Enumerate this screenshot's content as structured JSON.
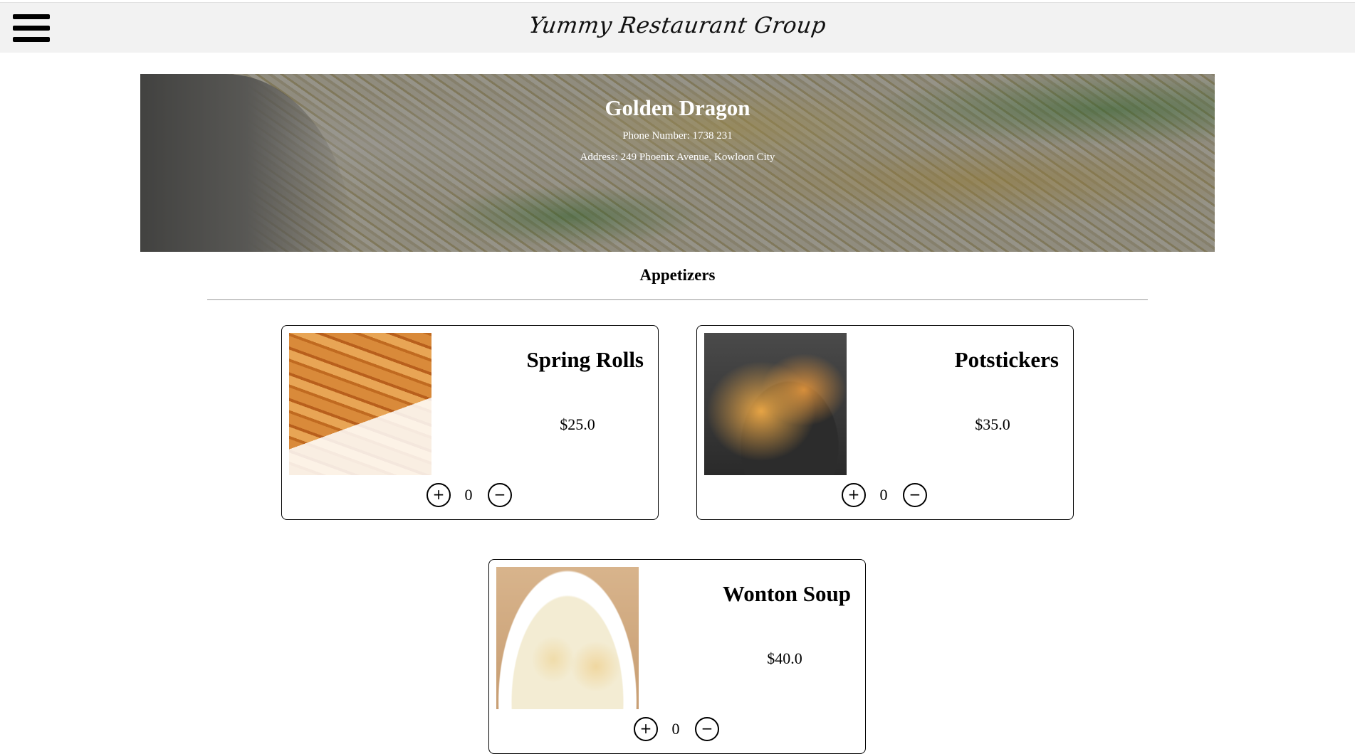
{
  "header": {
    "title": "Yummy Restaurant Group",
    "menu_icon": "hamburger-menu-icon"
  },
  "restaurant": {
    "name": "Golden Dragon",
    "phone_line": "Phone Number: 1738 231",
    "address_line": "Address: 249 Phoenix Avenue, Kowloon City"
  },
  "section": {
    "title": "Appetizers"
  },
  "items": [
    {
      "name": "Spring Rolls",
      "price": "$25.0",
      "quantity": "0",
      "plus_icon": "plus-circle-icon",
      "minus_icon": "minus-circle-icon"
    },
    {
      "name": "Potstickers",
      "price": "$35.0",
      "quantity": "0",
      "plus_icon": "plus-circle-icon",
      "minus_icon": "minus-circle-icon"
    },
    {
      "name": "Wonton Soup",
      "price": "$40.0",
      "quantity": "0",
      "plus_icon": "plus-circle-icon",
      "minus_icon": "minus-circle-icon"
    }
  ],
  "symbols": {
    "plus": "+",
    "minus": "−"
  }
}
